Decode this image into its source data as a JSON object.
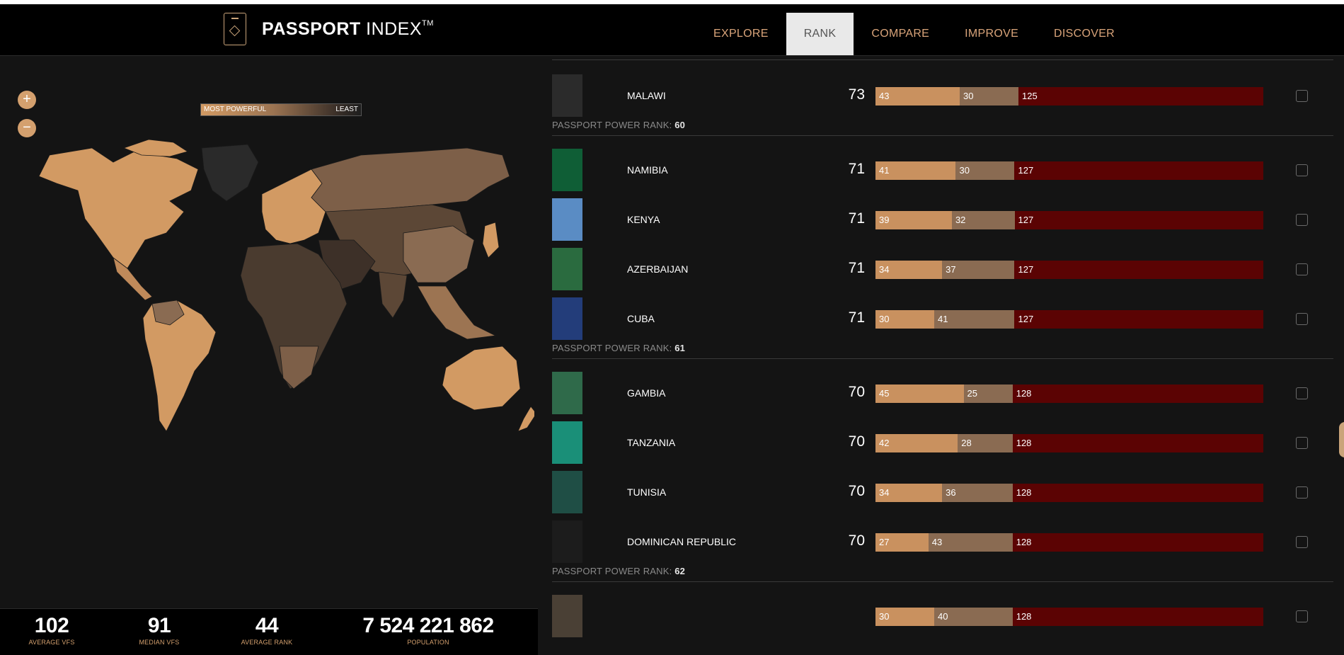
{
  "header": {
    "logo_bold": "PASSPORT",
    "logo_light": "INDEX",
    "logo_tm": "TM",
    "nav": [
      {
        "label": "EXPLORE",
        "active": false
      },
      {
        "label": "RANK",
        "active": true
      },
      {
        "label": "COMPARE",
        "active": false
      },
      {
        "label": "IMPROVE",
        "active": false
      },
      {
        "label": "DISCOVER",
        "active": false
      }
    ]
  },
  "map": {
    "zoom_in": "+",
    "zoom_out": "−",
    "legend_left": "MOST POWERFUL",
    "legend_right": "LEAST",
    "colors": {
      "powerful": "#d29a63",
      "mid": "#7d5f48",
      "least": "#2a2a2a"
    }
  },
  "stats": [
    {
      "value": "102",
      "label": "AVERAGE VFS"
    },
    {
      "value": "91",
      "label": "MEDIAN VFS"
    },
    {
      "value": "44",
      "label": "AVERAGE RANK"
    },
    {
      "value": "7 524 221 862",
      "label": "POPULATION"
    }
  ],
  "rank_prefix": "PASSPORT POWER RANK:",
  "list": [
    {
      "type": "row",
      "name": "MALAWI",
      "score": "73",
      "vf": 43,
      "voa": 30,
      "vr": 125,
      "passport_color": "#2b2b2b"
    },
    {
      "type": "rank",
      "rank": "60"
    },
    {
      "type": "row",
      "name": "NAMIBIA",
      "score": "71",
      "vf": 41,
      "voa": 30,
      "vr": 127,
      "passport_color": "#0f5e36"
    },
    {
      "type": "row",
      "name": "KENYA",
      "score": "71",
      "vf": 39,
      "voa": 32,
      "vr": 127,
      "passport_color": "#5a8cc4"
    },
    {
      "type": "row",
      "name": "AZERBAIJAN",
      "score": "71",
      "vf": 34,
      "voa": 37,
      "vr": 127,
      "passport_color": "#2a6b3f"
    },
    {
      "type": "row",
      "name": "CUBA",
      "score": "71",
      "vf": 30,
      "voa": 41,
      "vr": 127,
      "passport_color": "#233d7a"
    },
    {
      "type": "rank",
      "rank": "61"
    },
    {
      "type": "row",
      "name": "GAMBIA",
      "score": "70",
      "vf": 45,
      "voa": 25,
      "vr": 128,
      "passport_color": "#2f6a4a"
    },
    {
      "type": "row",
      "name": "TANZANIA",
      "score": "70",
      "vf": 42,
      "voa": 28,
      "vr": 128,
      "passport_color": "#1a8f78"
    },
    {
      "type": "row",
      "name": "TUNISIA",
      "score": "70",
      "vf": 34,
      "voa": 36,
      "vr": 128,
      "passport_color": "#1f4e45"
    },
    {
      "type": "row",
      "name": "DOMINICAN REPUBLIC",
      "score": "70",
      "vf": 27,
      "voa": 43,
      "vr": 128,
      "passport_color": "#1c1c1c"
    },
    {
      "type": "rank",
      "rank": "62"
    },
    {
      "type": "row",
      "name": "",
      "score": "",
      "vf": 30,
      "voa": 40,
      "vr": 128,
      "passport_color": "#4a4035"
    }
  ]
}
